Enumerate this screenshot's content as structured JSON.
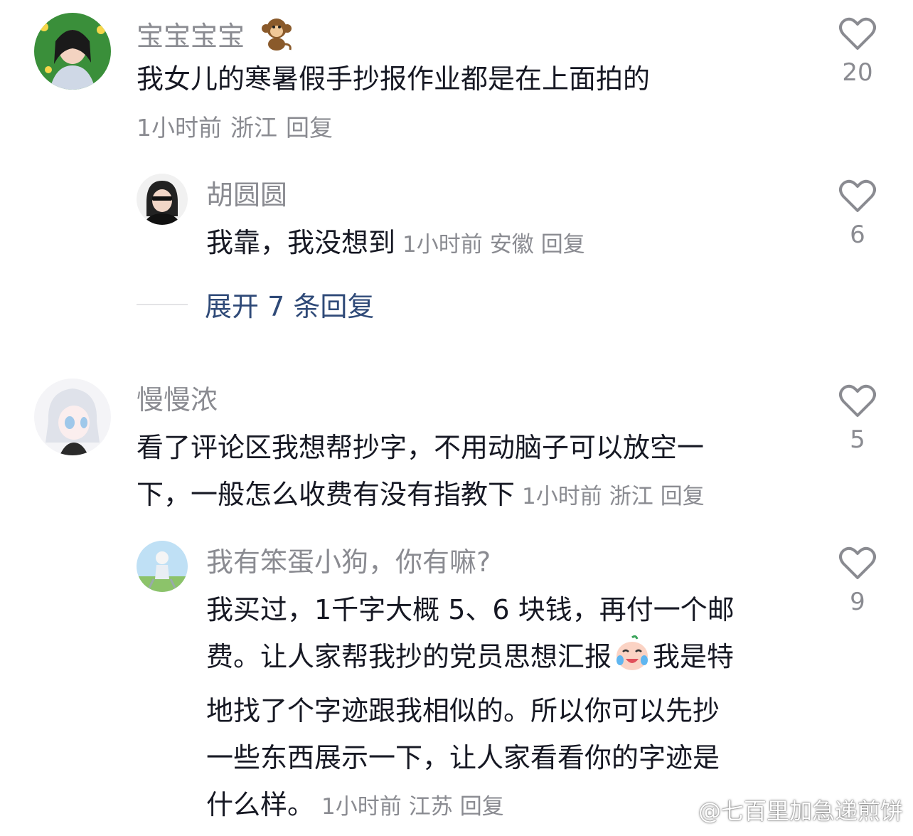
{
  "comments": [
    {
      "username": "宝宝宝宝",
      "emoji": "monkey-emoji",
      "text": "我女儿的寒暑假手抄报作业都是在上面拍的",
      "time": "1小时前",
      "location": "浙江",
      "reply": "回复",
      "likes": "20",
      "replies": [
        {
          "username": "胡圆圆",
          "text": "我靠，我没想到",
          "time": "1小时前",
          "location": "安徽",
          "reply": "回复",
          "likes": "6"
        }
      ],
      "expand_label": "展开 7 条回复"
    },
    {
      "username": "慢慢浓",
      "text_line1": "看了评论区我想帮抄字，不用动脑子可以放空一",
      "text_line2": "下，一般怎么收费有没有指教下",
      "time": "1小时前",
      "location": "浙江",
      "reply": "回复",
      "likes": "5",
      "replies": [
        {
          "username": "我有笨蛋小狗，你有嘛?",
          "lines": [
            "我买过，1千字大概 5、6 块钱，再付一个邮",
            "费。让人家帮我抄的党员思想汇报",
            "我是特",
            "地找了个字迹跟我相似的。所以你可以先抄",
            "一些东西展示一下，让人家看看你的字迹是",
            "什么样。"
          ],
          "inline_emoji": "crying-laugh-emoji",
          "time": "1小时前",
          "location": "江苏",
          "reply": "回复",
          "likes": "9"
        }
      ]
    }
  ],
  "watermark": "@七百里加急递煎饼",
  "colors": {
    "text": "#161823",
    "meta": "#8a8b91",
    "expand": "#2f4a78",
    "heart_stroke": "#8a8b91"
  }
}
